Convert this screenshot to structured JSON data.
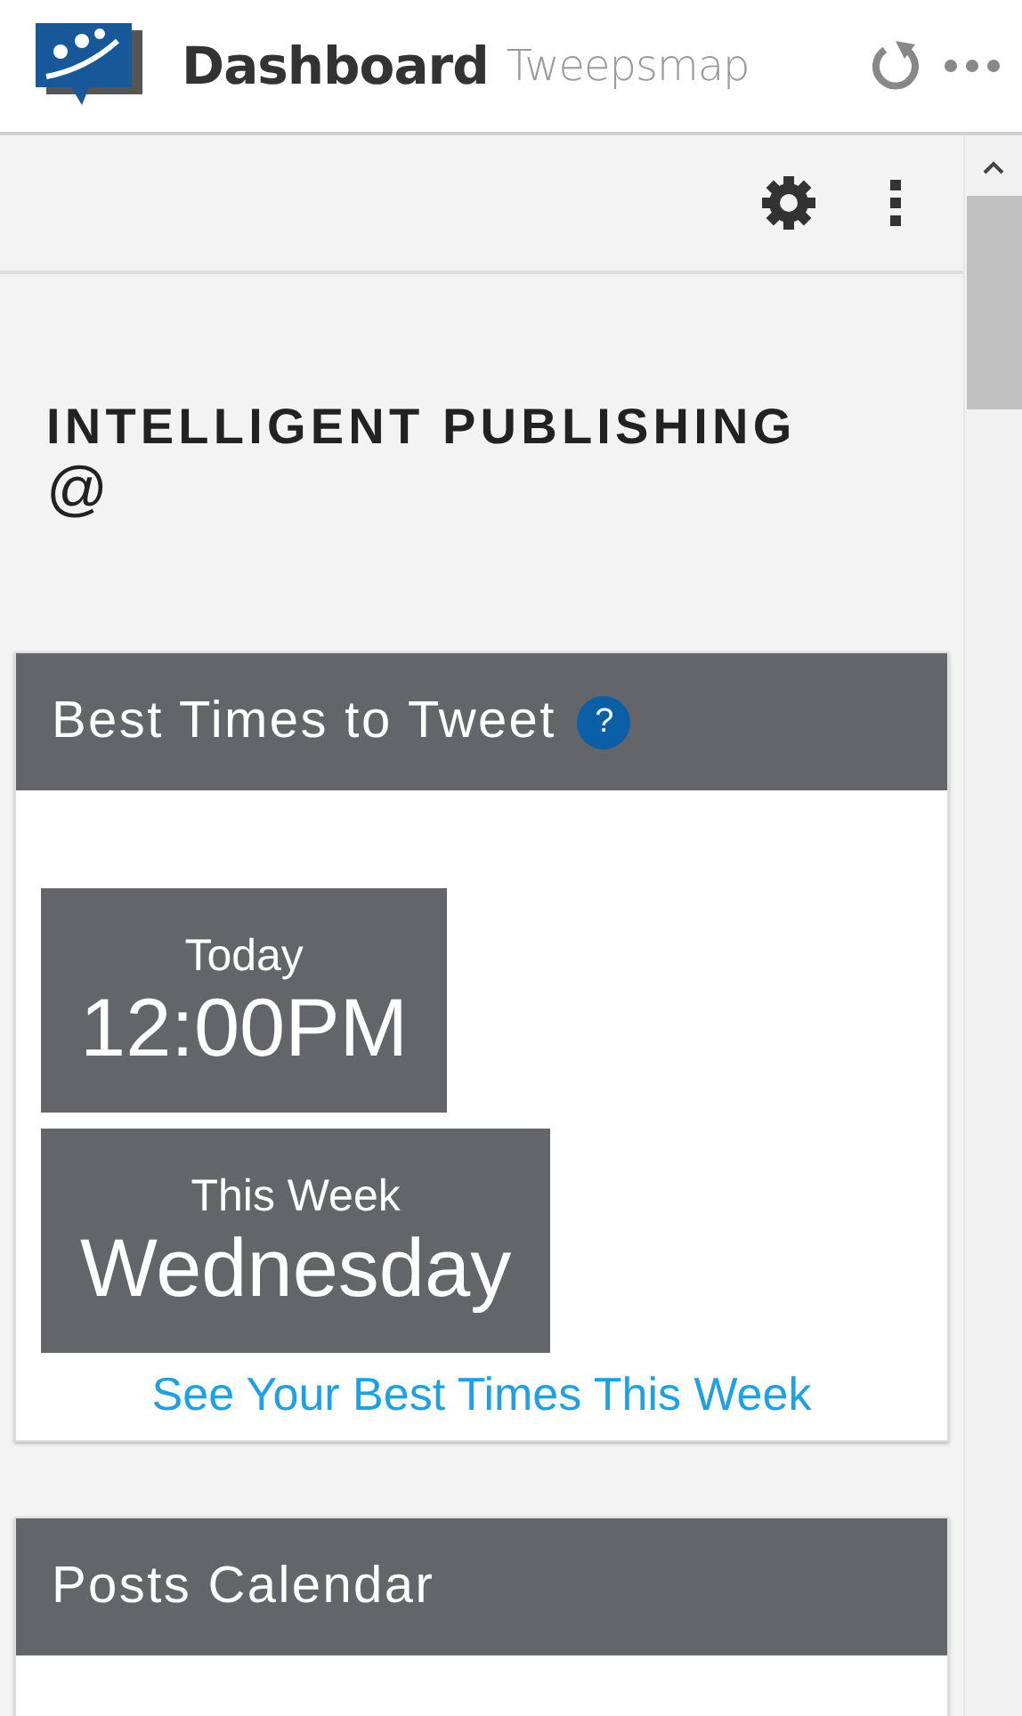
{
  "header": {
    "title": "Dashboard",
    "subtitle": "Tweepsmap"
  },
  "section": {
    "title": "INTELLIGENT PUBLISHING",
    "handle": "@"
  },
  "cards": [
    {
      "kind": "times",
      "title": "Best Times to Tweet",
      "help": "?",
      "tiles": [
        {
          "label": "Today",
          "value": "12:00PM"
        },
        {
          "label": "This Week",
          "value": "Wednesday"
        }
      ],
      "link": "See Your Best Times This Week"
    },
    {
      "kind": "calendar",
      "title": "Posts Calendar"
    }
  ]
}
